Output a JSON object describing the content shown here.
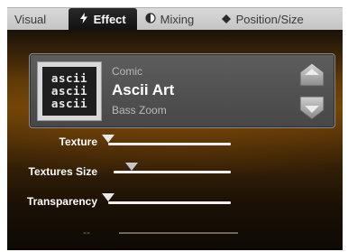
{
  "tabs": [
    {
      "label": "Visual",
      "icon": ""
    },
    {
      "label": "Effect",
      "icon": "lightning-icon"
    },
    {
      "label": "Mixing",
      "icon": "half-circle-icon"
    },
    {
      "label": "Position/Size",
      "icon": "diamond-icon"
    }
  ],
  "active_tab": "Effect",
  "effect": {
    "thumbnail_text": "ascii\nascii\nascii",
    "category": "Comic",
    "name": "Ascii Art",
    "variant": "Bass Zoom"
  },
  "parameters": [
    {
      "label": "Texture",
      "value": 0.0
    },
    {
      "label": "Textures Size",
      "value": 0.15
    },
    {
      "label": "Transparency",
      "value": 0.0
    }
  ],
  "disabled_parameter": {
    "label": "--"
  },
  "colors": {
    "accent": "#ffffff",
    "panel_mid": "#6e4208",
    "panel_dark": "#0e0a05"
  }
}
